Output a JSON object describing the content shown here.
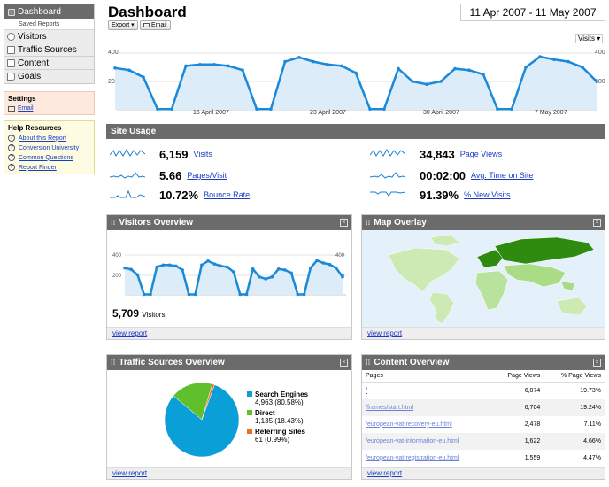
{
  "sidebar": {
    "dashboard": "Dashboard",
    "saved_reports": "Saved Reports",
    "items": [
      {
        "label": "Visitors",
        "icon": "visitors-icon"
      },
      {
        "label": "Traffic Sources",
        "icon": "traffic-icon"
      },
      {
        "label": "Content",
        "icon": "content-icon"
      },
      {
        "label": "Goals",
        "icon": "goals-icon"
      }
    ],
    "settings_title": "Settings",
    "settings_email": "Email",
    "help_title": "Help Resources",
    "help_items": [
      "About this Report",
      "Conversion University",
      "Common Questions",
      "Report Finder"
    ]
  },
  "header": {
    "title": "Dashboard",
    "export_label": "Export ▾",
    "email_label": "Email",
    "date_range": "11 Apr 2007 - 11 May 2007",
    "metric_select": "Visits ▾"
  },
  "main_chart": {
    "y_top": "400",
    "y_mid": "200",
    "x_labels": [
      "16 April 2007",
      "23 April 2007",
      "30 April 2007",
      "7 May 2007"
    ],
    "values": [
      295,
      280,
      230,
      5,
      5,
      310,
      320,
      320,
      310,
      280,
      5,
      5,
      340,
      370,
      340,
      320,
      310,
      260,
      5,
      5,
      290,
      200,
      180,
      200,
      290,
      280,
      250,
      5,
      5,
      300,
      375,
      355,
      340,
      300,
      200
    ]
  },
  "site_usage": {
    "title": "Site Usage",
    "metrics": [
      {
        "value": "6,159",
        "label": "Visits"
      },
      {
        "value": "5.66",
        "label": "Pages/Visit"
      },
      {
        "value": "10.72%",
        "label": "Bounce Rate"
      },
      {
        "value": "34,843",
        "label": "Page Views"
      },
      {
        "value": "00:02:00",
        "label": "Avg. Time on Site"
      },
      {
        "value": "91.39%",
        "label": "% New Visits"
      }
    ]
  },
  "visitors_overview": {
    "title": "Visitors Overview",
    "y_top": "400",
    "y_mid": "200",
    "total": "5,709",
    "total_label": "Visitors",
    "view_report": "view report",
    "values": [
      270,
      255,
      200,
      5,
      5,
      280,
      300,
      300,
      290,
      250,
      5,
      5,
      300,
      340,
      310,
      290,
      280,
      230,
      5,
      5,
      260,
      180,
      160,
      180,
      260,
      250,
      220,
      5,
      5,
      270,
      345,
      320,
      305,
      270,
      180
    ]
  },
  "map_overlay": {
    "title": "Map Overlay",
    "view_report": "view report"
  },
  "traffic_sources": {
    "title": "Traffic Sources Overview",
    "view_report": "view report",
    "slices": [
      {
        "name": "Search Engines",
        "detail": "4,963 (80.58%)",
        "pct": 80.58,
        "color": "#0b9fd8"
      },
      {
        "name": "Direct",
        "detail": "1,135 (18.43%)",
        "pct": 18.43,
        "color": "#5fbf2d"
      },
      {
        "name": "Referring Sites",
        "detail": "61 (0.99%)",
        "pct": 0.99,
        "color": "#f06a28"
      }
    ]
  },
  "content_overview": {
    "title": "Content Overview",
    "col_pages": "Pages",
    "col_views": "Page Views",
    "col_pct": "% Page Views",
    "view_report": "view report",
    "rows": [
      {
        "page": "/",
        "views": "6,874",
        "pct": "19.73%"
      },
      {
        "page": "/frames/start.html",
        "views": "6,704",
        "pct": "19.24%"
      },
      {
        "page": "/european-vat-recovery-eu.html",
        "views": "2,478",
        "pct": "7.11%"
      },
      {
        "page": "/european-vat-information-eu.html",
        "views": "1,622",
        "pct": "4.66%"
      },
      {
        "page": "/european-vat-registration-eu.html",
        "views": "1,559",
        "pct": "4.47%"
      }
    ]
  }
}
